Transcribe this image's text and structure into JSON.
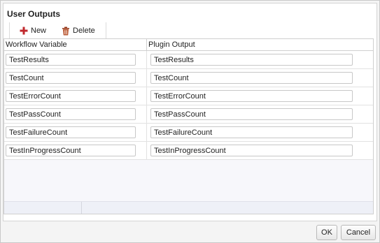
{
  "panel": {
    "title": "User Outputs"
  },
  "toolbar": {
    "new_label": "New",
    "new_icon": "plus-icon",
    "new_icon_color": "#c0282d",
    "delete_label": "Delete",
    "delete_icon": "trash-icon",
    "delete_icon_color": "#9a3b1c"
  },
  "grid": {
    "columns": [
      "Workflow Variable",
      "Plugin Output"
    ],
    "rows": [
      {
        "workflow_variable": "TestResults",
        "plugin_output": "TestResults"
      },
      {
        "workflow_variable": "TestCount",
        "plugin_output": "TestCount"
      },
      {
        "workflow_variable": "TestErrorCount",
        "plugin_output": "TestErrorCount"
      },
      {
        "workflow_variable": "TestPassCount",
        "plugin_output": "TestPassCount"
      },
      {
        "workflow_variable": "TestFailureCount",
        "plugin_output": "TestFailureCount"
      },
      {
        "workflow_variable": "TestInProgressCount",
        "plugin_output": "TestInProgressCount"
      }
    ]
  },
  "buttons": {
    "ok_label": "OK",
    "cancel_label": "Cancel"
  }
}
